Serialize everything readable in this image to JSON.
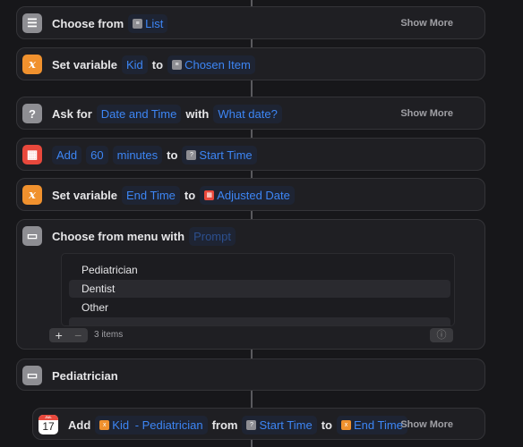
{
  "actions": {
    "choose_list": {
      "label": "Choose from",
      "token": "List",
      "show_more": "Show More",
      "icon": "list-icon"
    },
    "set_kid": {
      "label": "Set variable",
      "var": "Kid",
      "to": "to",
      "value": "Chosen Item",
      "icon": "variable-icon"
    },
    "ask_for": {
      "label": "Ask for",
      "type": "Date and Time",
      "with": "with",
      "prompt": "What date?",
      "show_more": "Show More",
      "icon": "question-icon"
    },
    "adjust_date": {
      "verb": "Add",
      "amount": "60",
      "unit": "minutes",
      "to": "to",
      "target": "Start Time",
      "icon": "calendar-grid-icon"
    },
    "set_end": {
      "label": "Set variable",
      "var": "End Time",
      "to": "to",
      "value": "Adjusted Date",
      "icon": "variable-icon"
    },
    "choose_menu": {
      "label": "Choose from menu with",
      "prompt_placeholder": "Prompt",
      "items": [
        "Pediatrician",
        "Dentist",
        "Other"
      ],
      "count": "3 items",
      "add": "+",
      "remove": "−",
      "info": "ⓘ",
      "icon": "menu-icon"
    },
    "menu_case": {
      "label": "Pediatrician",
      "icon": "menu-icon"
    },
    "add_event": {
      "verb": "Add",
      "title_var": "Kid",
      "title_text": " - Pediatrician",
      "from": "from",
      "start": "Start Time",
      "to": "to",
      "end": "End Time",
      "show_more": "Show More",
      "cal_month": "JUL",
      "cal_day": "17",
      "icon": "calendar-icon"
    }
  }
}
